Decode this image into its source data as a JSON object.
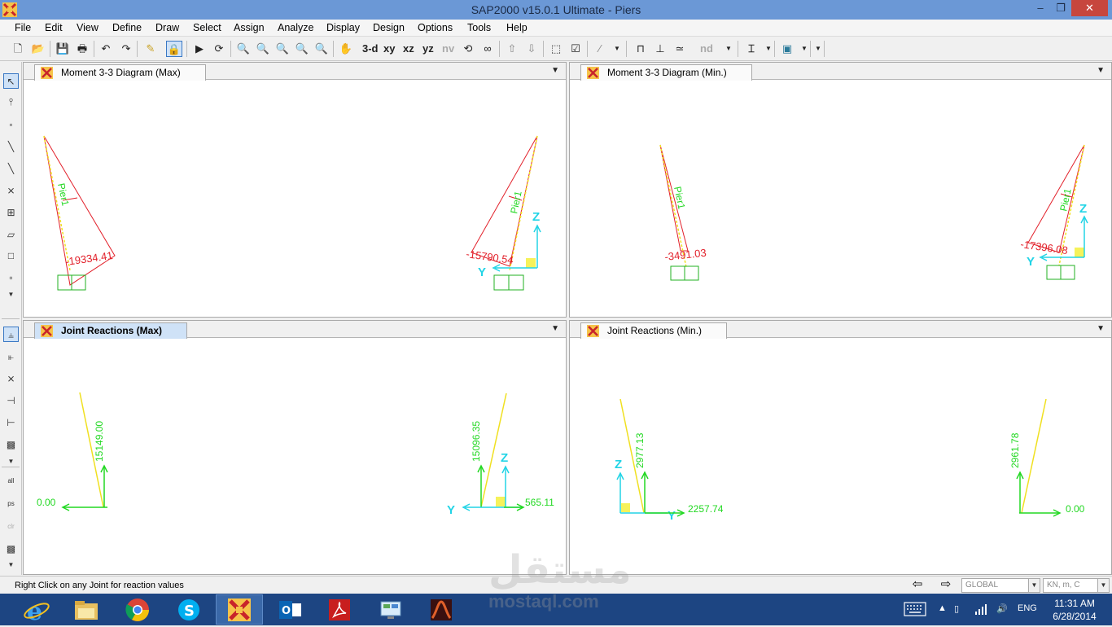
{
  "window": {
    "title": "SAP2000 v15.0.1 Ultimate  - Piers",
    "min": "–",
    "max": "❐",
    "close": "✕"
  },
  "menu": [
    "File",
    "Edit",
    "View",
    "Define",
    "Draw",
    "Select",
    "Assign",
    "Analyze",
    "Display",
    "Design",
    "Options",
    "Tools",
    "Help"
  ],
  "toolbar": {
    "xy": "xy",
    "xz": "xz",
    "yz": "yz",
    "nv": "nv",
    "nd": "nd",
    "three_d": "3-d"
  },
  "panes": [
    {
      "tab": "Moment 3-3 Diagram   (Max)",
      "member_labels": [
        "Pier1",
        "Pier1"
      ],
      "values": [
        "-19334.41",
        "-15790.54"
      ],
      "axis": [
        "Z",
        "Y"
      ]
    },
    {
      "tab": "Moment 3-3 Diagram   (Min.)",
      "member_labels": [
        "Pier1",
        "Pier1"
      ],
      "values": [
        "-3491.03",
        "-17396.08"
      ],
      "axis": [
        "Z",
        "Y"
      ]
    },
    {
      "tab": "Joint Reactions   (Max)",
      "values": [
        "15149.00",
        "0.00",
        "15096.35",
        "565.11"
      ],
      "axis": [
        "Z",
        "Y"
      ]
    },
    {
      "tab": "Joint Reactions   (Min.)",
      "values": [
        "2977.13",
        "2257.74",
        "2961.78",
        "0.00"
      ],
      "axis": [
        "Z",
        "Y"
      ]
    }
  ],
  "status": {
    "message": "Right Click on any Joint for reaction values",
    "coord_system": "GLOBAL",
    "units": "KN, m, C"
  },
  "taskbar": {
    "tray_lang": "ENG",
    "time": "11:31 AM",
    "date": "6/28/2014"
  },
  "watermark": {
    "ar": "مستقل",
    "en": "mostaql.com"
  },
  "colors": {
    "moment": "#e2202a",
    "member": "#f0e020",
    "reaction": "#22d822",
    "axis": "#22d4e6",
    "support": "#22b022",
    "accent": "#3a78c4"
  }
}
